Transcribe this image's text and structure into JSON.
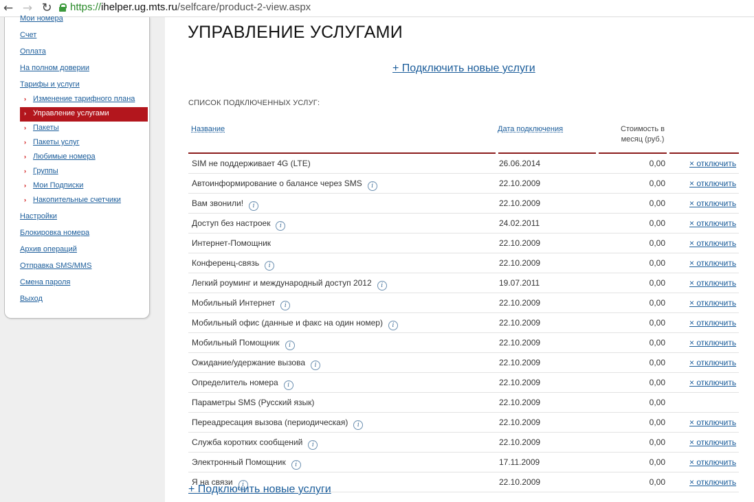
{
  "browser": {
    "url_scheme": "https://",
    "url_host": "ihelper.ug.mts.ru",
    "url_path": "/selfcare/product-2-view.aspx"
  },
  "sidebar": {
    "top_partial": "Мои номера",
    "items": [
      {
        "label": "Счет"
      },
      {
        "label": "Оплата"
      },
      {
        "label": "На полном доверии"
      },
      {
        "label": "Тарифы и услуги"
      }
    ],
    "subitems": [
      {
        "label": "Изменение тарифного плана"
      },
      {
        "label": "Управление услугами"
      },
      {
        "label": "Пакеты"
      },
      {
        "label": "Пакеты услуг"
      },
      {
        "label": "Любимые номера"
      },
      {
        "label": "Группы"
      },
      {
        "label": "Мои Подписки"
      },
      {
        "label": "Накопительные счетчики"
      }
    ],
    "items2": [
      {
        "label": "Настройки"
      },
      {
        "label": "Блокировка номера"
      },
      {
        "label": "Архив операций"
      },
      {
        "label": "Отправка SMS/MMS"
      },
      {
        "label": "Смена пароля"
      },
      {
        "label": "Выход"
      }
    ]
  },
  "main": {
    "title": "УПРАВЛЕНИЕ УСЛУГАМИ",
    "connect_label": "+ Подключить новые услуги",
    "list_title": "СПИСОК ПОДКЛЮЧЕННЫХ УСЛУГ:",
    "col_name": "Название",
    "col_date": "Дата подключения",
    "col_cost_line1": "Стоимость в",
    "col_cost_line2": "месяц (руб.)",
    "disable_label": "× отключить",
    "info_icon": "i",
    "connect_bottom_label": "+ Подключить новые услуги"
  },
  "services": [
    {
      "name": "SIM не поддерживает 4G (LTE)",
      "date": "26.06.2014",
      "cost": "0,00",
      "info": false,
      "disable": true
    },
    {
      "name": "Автоинформирование о балансе через SMS",
      "date": "22.10.2009",
      "cost": "0,00",
      "info": true,
      "disable": true
    },
    {
      "name": "Вам звонили!",
      "date": "22.10.2009",
      "cost": "0,00",
      "info": true,
      "disable": true
    },
    {
      "name": "Доступ без настроек",
      "date": "24.02.2011",
      "cost": "0,00",
      "info": true,
      "disable": true
    },
    {
      "name": "Интернет-Помощник",
      "date": "22.10.2009",
      "cost": "0,00",
      "info": false,
      "disable": true
    },
    {
      "name": "Конференц-связь",
      "date": "22.10.2009",
      "cost": "0,00",
      "info": true,
      "disable": true
    },
    {
      "name": "Легкий роуминг и международный доступ 2012",
      "date": "19.07.2011",
      "cost": "0,00",
      "info": true,
      "disable": true
    },
    {
      "name": "Мобильный Интернет",
      "date": "22.10.2009",
      "cost": "0,00",
      "info": true,
      "disable": true
    },
    {
      "name": "Мобильный офис (данные и факс на один номер)",
      "date": "22.10.2009",
      "cost": "0,00",
      "info": true,
      "disable": true
    },
    {
      "name": "Мобильный Помощник",
      "date": "22.10.2009",
      "cost": "0,00",
      "info": true,
      "disable": true
    },
    {
      "name": "Ожидание/удержание вызова",
      "date": "22.10.2009",
      "cost": "0,00",
      "info": true,
      "disable": true
    },
    {
      "name": "Определитель номера",
      "date": "22.10.2009",
      "cost": "0,00",
      "info": true,
      "disable": true
    },
    {
      "name": "Параметры SMS (Русский язык)",
      "date": "22.10.2009",
      "cost": "0,00",
      "info": false,
      "disable": false
    },
    {
      "name": "Переадресация вызова (периодическая)",
      "date": "22.10.2009",
      "cost": "0,00",
      "info": true,
      "disable": true
    },
    {
      "name": "Служба коротких сообщений",
      "date": "22.10.2009",
      "cost": "0,00",
      "info": true,
      "disable": true
    },
    {
      "name": "Электронный Помощник",
      "date": "17.11.2009",
      "cost": "0,00",
      "info": true,
      "disable": true
    },
    {
      "name": "Я на связи",
      "date": "22.10.2009",
      "cost": "0,00",
      "info": true,
      "disable": true
    }
  ],
  "colors": {
    "accent_red": "#b3161d",
    "link_blue": "#1a5c9a",
    "header_rule": "#8b1c1c"
  }
}
